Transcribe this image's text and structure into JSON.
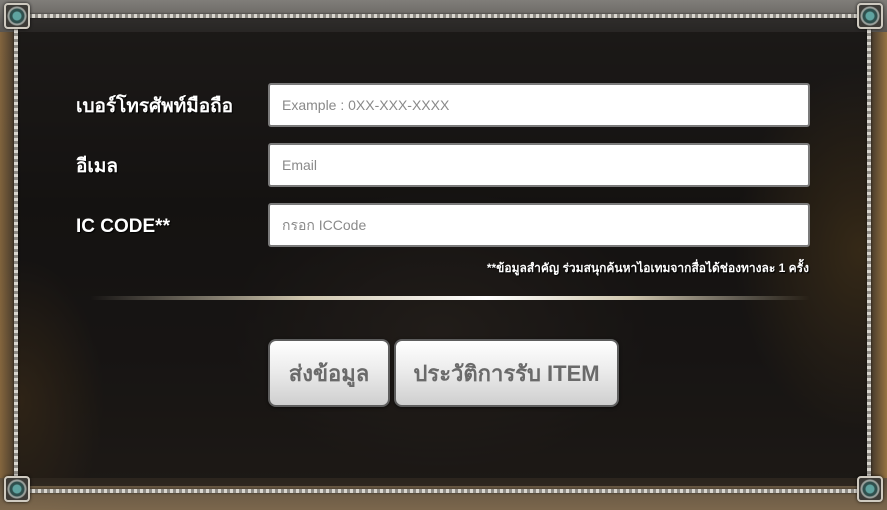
{
  "form": {
    "phone_label": "เบอร์โทรศัพท์มือถือ",
    "phone_placeholder": "Example : 0XX-XXX-XXXX",
    "email_label": "อีเมล",
    "email_placeholder": "Email",
    "iccode_label": "IC CODE**",
    "iccode_placeholder": "กรอก ICCode",
    "note": "**ข้อมูลสำคัญ ร่วมสนุกค้นหาไอเทมจากสื่อได้ช่องทางละ 1 ครั้ง"
  },
  "buttons": {
    "submit_label": "ส่งข้อมูล",
    "history_label": "ประวัติการรับ ITEM"
  }
}
